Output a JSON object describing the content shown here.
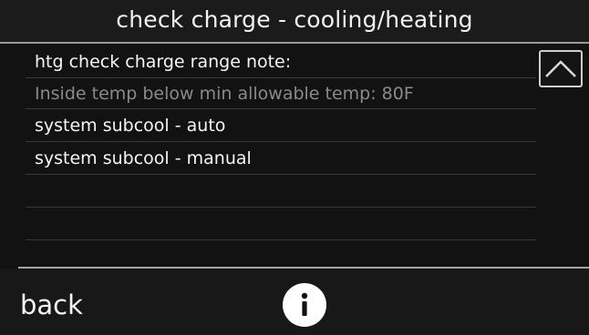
{
  "header": {
    "title": "check charge - cooling/heating"
  },
  "list": {
    "items": [
      {
        "label": "htg check charge range note:"
      },
      {
        "label": "Inside temp below min allowable temp: 80F"
      },
      {
        "label": "system subcool - auto"
      },
      {
        "label": "system subcool - manual"
      }
    ]
  },
  "footer": {
    "back_label": "back"
  },
  "icons": {
    "scroll_up": "chevron-up-icon",
    "info": "info-icon"
  },
  "colors": {
    "background": "#121212",
    "text": "#f5f5f5",
    "muted_text": "#8a8a8a",
    "divider": "#a5a5a5"
  }
}
